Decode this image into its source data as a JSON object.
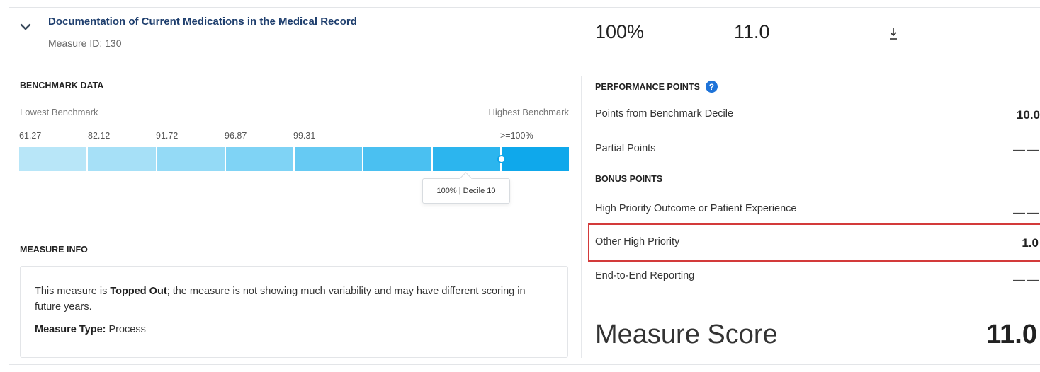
{
  "header": {
    "title": "Documentation of Current Medications in the Medical Record",
    "measure_id": "Measure ID: 130",
    "performance_rate": "100%",
    "total_points": "11.0",
    "download_icon": "download-icon",
    "chevron_icon": "chevron-down-icon"
  },
  "benchmark": {
    "label": "BENCHMARK DATA",
    "lowest": "Lowest Benchmark",
    "highest": "Highest Benchmark",
    "ticks": [
      "61.27",
      "82.12",
      "91.72",
      "96.87",
      "99.31",
      "-- --",
      "-- --",
      ">=100%"
    ],
    "tooltip": "100% | Decile 10",
    "current_decile": 10,
    "segment_colors": [
      "#b8e6f8",
      "#a6e0f7",
      "#94daf6",
      "#7fd3f5",
      "#66caf3",
      "#4ac0f1",
      "#2cb5ee",
      "#0fa8eb"
    ]
  },
  "measure_info": {
    "label": "MEASURE INFO",
    "text_prefix": "This measure is ",
    "text_bold": "Topped Out",
    "text_suffix": "; the measure is not showing much variability and may have different scoring in future years.",
    "type_label": "Measure Type:",
    "type_value": " Process"
  },
  "performance_points": {
    "label": "PERFORMANCE POINTS",
    "help_icon": "?",
    "rows": [
      {
        "label": "Points from Benchmark Decile",
        "value": "10.0"
      },
      {
        "label": "Partial Points",
        "value": "——"
      }
    ],
    "bonus_label": "BONUS POINTS",
    "bonus_rows": [
      {
        "label": "High Priority Outcome or Patient Experience",
        "value": "——"
      },
      {
        "label": "Other High Priority",
        "value": "1.0"
      },
      {
        "label": "End-to-End Reporting",
        "value": "——"
      }
    ],
    "score_label": "Measure Score",
    "score_value": "11.0"
  },
  "colors": {
    "title": "#1f3f6e",
    "highlight": "#d33a3a",
    "help": "#1e73d8"
  }
}
